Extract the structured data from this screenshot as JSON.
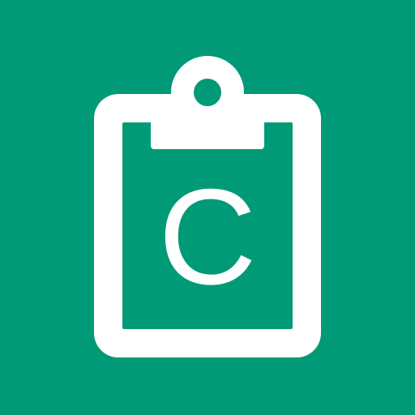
{
  "icon": {
    "name": "clipboard-icon",
    "letter": "C",
    "colors": {
      "background": "#009b76",
      "foreground": "#ffffff"
    }
  }
}
